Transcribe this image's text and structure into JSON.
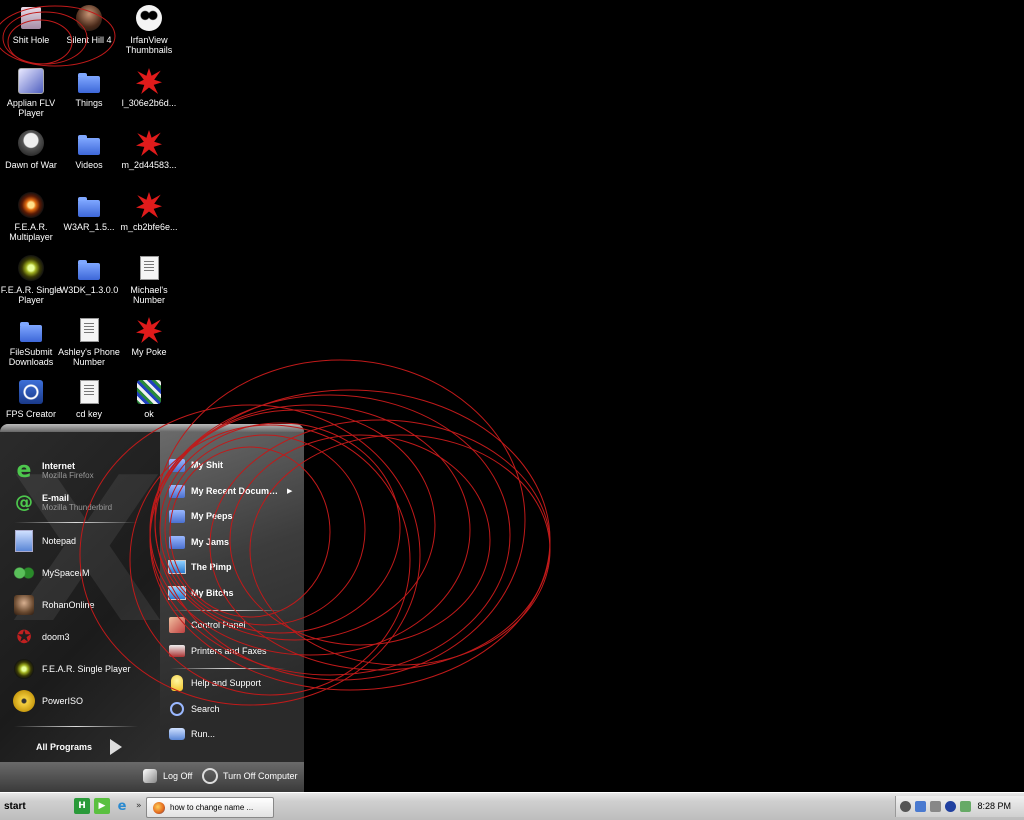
{
  "desktop": {
    "icons": [
      {
        "label": "Shit Hole",
        "icon": "recycle-bin-icon"
      },
      {
        "label": "Silent Hill 4",
        "icon": "game-character-icon"
      },
      {
        "label": "IrfanView Thumbnails",
        "icon": "panda-icon"
      },
      {
        "label": "Applian FLV Player",
        "icon": "flv-player-icon"
      },
      {
        "label": "Things",
        "icon": "folder-icon"
      },
      {
        "label": "l_306e2b6d...",
        "icon": "red-splat-icon"
      },
      {
        "label": "Dawn of War",
        "icon": "skull-icon"
      },
      {
        "label": "Videos",
        "icon": "folder-icon"
      },
      {
        "label": "m_2d44583...",
        "icon": "red-splat-icon"
      },
      {
        "label": "F.E.A.R. Multiplayer",
        "icon": "fear-eye-icon"
      },
      {
        "label": "W3AR_1.5...",
        "icon": "folder-icon"
      },
      {
        "label": "m_cb2bfe6e...",
        "icon": "red-splat-icon"
      },
      {
        "label": "F.E.A.R. Single Player",
        "icon": "fear-eye-icon"
      },
      {
        "label": "W3DK_1.3.0.0",
        "icon": "folder-icon"
      },
      {
        "label": "Michael's Number",
        "icon": "text-document-icon"
      },
      {
        "label": "FileSubmit Downloads",
        "icon": "folder-icon"
      },
      {
        "label": "Ashley's Phone Number",
        "icon": "text-document-icon"
      },
      {
        "label": "My Poke",
        "icon": "red-splat-icon"
      },
      {
        "label": "FPS Creator",
        "icon": "crosshair-icon"
      },
      {
        "label": "cd key",
        "icon": "text-document-icon"
      },
      {
        "label": "ok",
        "icon": "image-file-icon"
      }
    ]
  },
  "start_menu": {
    "pinned": [
      {
        "title": "Internet",
        "subtitle": "Mozilla Firefox",
        "icon": "internet-icon"
      },
      {
        "title": "E-mail",
        "subtitle": "Mozilla Thunderbird",
        "icon": "email-icon"
      }
    ],
    "recent": [
      {
        "title": "Notepad",
        "icon": "notepad-icon"
      },
      {
        "title": "MySpaceIM",
        "icon": "myspaceim-icon"
      },
      {
        "title": "RohanOnline",
        "icon": "rohan-icon"
      },
      {
        "title": "doom3",
        "icon": "pentagram-icon"
      },
      {
        "title": "F.E.A.R. Single Player",
        "icon": "fear-eye-icon"
      },
      {
        "title": "PowerISO",
        "icon": "cd-icon"
      }
    ],
    "all_programs": "All Programs",
    "places": [
      {
        "title": "My Shit",
        "icon": "documents-folder-icon"
      },
      {
        "title": "My Recent Documents",
        "icon": "recent-documents-icon"
      },
      {
        "title": "My Peeps",
        "icon": "pictures-folder-icon"
      },
      {
        "title": "My Jams",
        "icon": "music-folder-icon"
      },
      {
        "title": "The Pimp",
        "icon": "computer-icon"
      },
      {
        "title": "My Bitchs",
        "icon": "network-icon"
      }
    ],
    "system": [
      {
        "title": "Control Panel",
        "icon": "control-panel-icon"
      },
      {
        "title": "Printers and Faxes",
        "icon": "printer-icon"
      }
    ],
    "help": [
      {
        "title": "Help and Support",
        "icon": "lightbulb-icon"
      },
      {
        "title": "Search",
        "icon": "search-icon"
      },
      {
        "title": "Run...",
        "icon": "run-icon"
      }
    ],
    "log_off": "Log Off",
    "turn_off": "Turn Off Computer"
  },
  "taskbar": {
    "start_label": "start",
    "quick_launch_more": "»",
    "task_button": "how to change name ...",
    "clock": "8:28 PM"
  },
  "colors": {
    "desktop_background": "#000000",
    "circle_stroke": "#c01a1a"
  }
}
